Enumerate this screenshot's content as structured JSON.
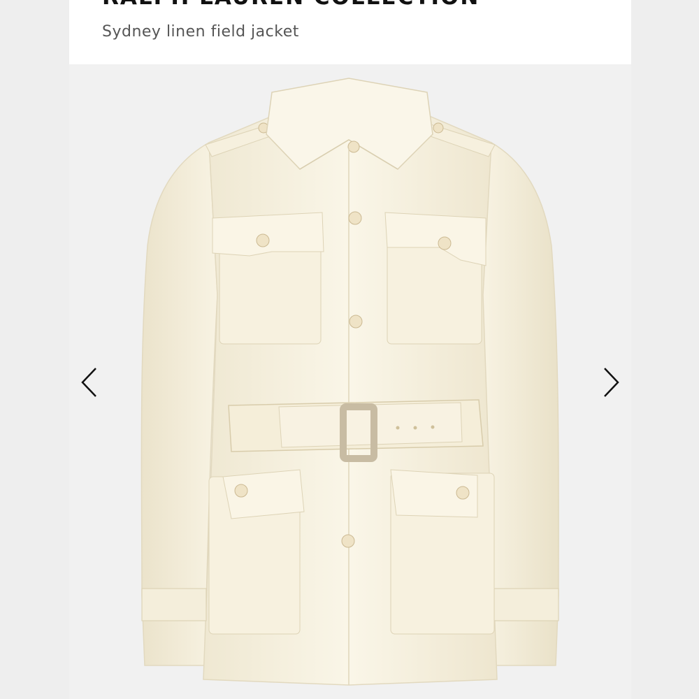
{
  "header": {
    "brand": "RALPH LAUREN COLLECTION",
    "product_name": "Sydney linen field jacket"
  },
  "gallery": {
    "prev_icon": "chevron-left-icon",
    "next_icon": "chevron-right-icon",
    "image_subject": "cream linen belted field jacket with four flap pockets"
  },
  "colors": {
    "background": "#f1f1f1",
    "jacket": "#f7f2e1",
    "accent_text": "#111111"
  }
}
